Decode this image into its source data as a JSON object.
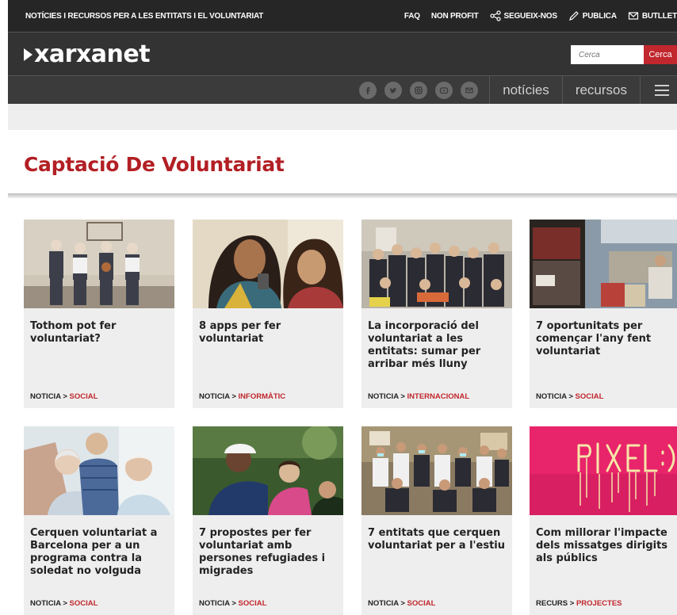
{
  "topbar": {
    "tagline": "NOTÍCIES I RECURSOS PER A LES ENTITATS I EL VOLUNTARIAT",
    "links": [
      "FAQ",
      "NON PROFIT",
      "SEGUEIX-NOS",
      "PUBLICA",
      "BUTLLET"
    ]
  },
  "brand": {
    "logo": "xarxanet"
  },
  "search": {
    "placeholder": "Cerca",
    "button": "Cerca"
  },
  "nav": {
    "items": [
      "notícies",
      "recursos"
    ]
  },
  "social_icons": [
    "facebook-icon",
    "twitter-icon",
    "instagram-icon",
    "youtube-icon",
    "email-icon"
  ],
  "page": {
    "title": "Captació De Voluntariat"
  },
  "colors": {
    "accent": "#c1272d",
    "dark": "#262626",
    "card_bg": "#eeeeee"
  },
  "cards": [
    {
      "title": "Tothom pot fer voluntariat?",
      "type": "NOTICIA",
      "sep": " > ",
      "category": "SOCIAL"
    },
    {
      "title": "8 apps per fer voluntariat",
      "type": "NOTICIA",
      "sep": " > ",
      "category": "INFORMÀTIC"
    },
    {
      "title": "La incorporació del voluntariat a les entitats: sumar per arribar més lluny",
      "type": "NOTICIA",
      "sep": " > ",
      "category": "INTERNACIONAL"
    },
    {
      "title": "7 oportunitats per començar l'any fent voluntariat",
      "type": "NOTICIA",
      "sep": " > ",
      "category": "SOCIAL"
    },
    {
      "title": "Cerquen voluntariat a Barcelona per a un programa contra la soledat no volguda",
      "type": "NOTICIA",
      "sep": " > ",
      "category": "SOCIAL"
    },
    {
      "title": "7 propostes per fer voluntariat amb persones refugiades i migrades",
      "type": "NOTICIA",
      "sep": " > ",
      "category": "SOCIAL"
    },
    {
      "title": "7 entitats que cerquen voluntariat per a l'estiu",
      "type": "NOTICIA",
      "sep": " > ",
      "category": "SOCIAL"
    },
    {
      "title": "Com millorar l'impacte dels missatges dirigits als públics",
      "type": "RECURS",
      "sep": " > ",
      "category": "PROJECTES"
    }
  ]
}
